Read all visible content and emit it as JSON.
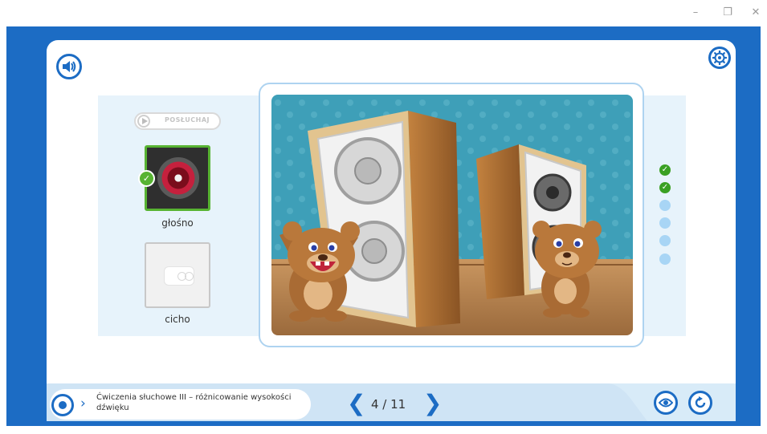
{
  "window": {
    "minimize_glyph": "–",
    "restore_glyph": "❐",
    "close_glyph": "✕"
  },
  "colors": {
    "frame_blue": "#1c6cc4",
    "content_bg": "#e7f3fb",
    "done_green": "#3aa023",
    "todo_blue": "#a8d5f5"
  },
  "header": {
    "audio_icon": "speaker-icon",
    "settings_icon": "gear-icon"
  },
  "exercise": {
    "listen_label": "POSŁUCHAJ",
    "options": [
      {
        "label": "głośno",
        "icon": "speaker-icon",
        "selected": true,
        "correct": true
      },
      {
        "label": "cicho",
        "icon": "radio-icon",
        "selected": false,
        "correct": false
      }
    ]
  },
  "progress": {
    "steps": [
      "done",
      "done",
      "todo",
      "todo",
      "todo",
      "todo"
    ],
    "done_glyph": "✓"
  },
  "footer": {
    "lesson_title": "Ćwiczenia słuchowe III – różnicowanie wysokości dźwięku",
    "page_counter": "4 / 11",
    "prev_glyph": "❮",
    "next_glyph": "❯",
    "menu_chevron": "›"
  }
}
